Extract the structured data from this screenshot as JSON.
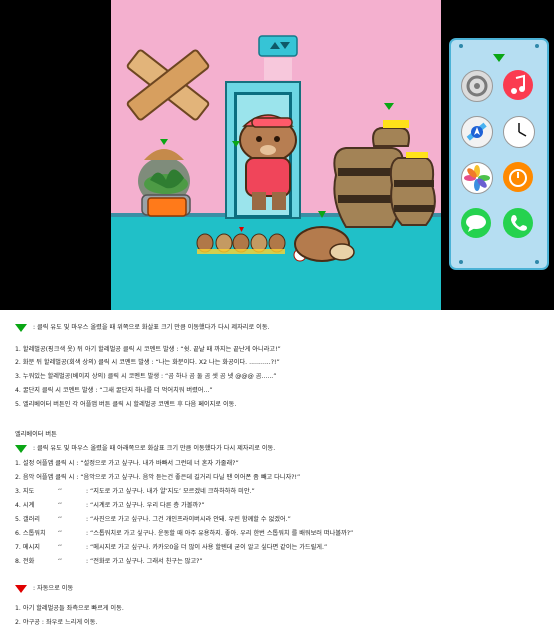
{
  "scene": {
    "colors": {
      "wall": "#f4b0cf",
      "floor": "#20c0c8",
      "phone_border": "#4bb2d6",
      "phone_bg": "#b6def2"
    },
    "elevator_button_icon": "elevator-up-down-icon",
    "apps": [
      {
        "name": "settings-app-icon",
        "color": "#d9d9d9"
      },
      {
        "name": "music-app-icon",
        "color": "#fb3b50"
      },
      {
        "name": "maps-app-icon",
        "color": "#f2f2f2"
      },
      {
        "name": "clock-app-icon",
        "color": "#ffffff"
      },
      {
        "name": "photos-app-icon",
        "color": "#ffffff"
      },
      {
        "name": "stopwatch-app-icon",
        "color": "#ff8a00"
      },
      {
        "name": "messages-app-icon",
        "color": "#25d24f"
      },
      {
        "name": "phone-app-icon",
        "color": "#25d24f"
      }
    ]
  },
  "notes": {
    "green_section": {
      "intro": ": 클릭 유도 및 마우스 올렸을 때 위쪽으로 화살표 크기 만큼 이동했다가 다시 제자리로 이동.",
      "items": [
        "1. 할레벌공(핑크색 옷) 뒤 아기 할레벌공 클릭 시 코멘트 발생 : “쉿. 끝날 때 까지는 끝난게 아니라고!”",
        "2. 화분 뒤 할레벌공(회색 상의) 클릭 시 코멘트 발생 : “나는 화분이다. X2 나는 화공이다. ...........?!”",
        "3. 누워있는 할레벌공(베이지 상의) 클릭 시 코멘트 발생 : “곰 하나 곰 둘 곰 셋 곰 넷 @@@ 곰......”",
        "4. 꿀단지 클릭 시 코멘트 발생 : “그새 꿀단지 하나를 더 먹어치워 버렸어...”",
        "5. 엘리베이터 버튼인 각 어플앱 버튼 클릭 시 할레벌공 코멘트 후 다음 페이지로 이동."
      ]
    },
    "elevator_title": "엘리베이터 버튼",
    "elevator_section": {
      "intro": ": 클릭 유도 및 마우스 올렸을 때 아래쪽으로 화살표 크기 만큼 이동했다가 다시 제자리로 이동.",
      "items": [
        {
          "num": "1. 설정 어플앱 클릭 시 : “설정으로 가고 싶구나. 내가 바빠서 그런데 너 혼자 가줄래?”"
        },
        {
          "num": "2. 음악 어플앱 클릭 시 : “음악으로 가고 싶구나. 음악 듣는건 좋은데 길거리 다닐 땐 이어폰 좀 빼고 다니자?!”"
        },
        {
          "num": "3. 지도",
          "mark": "‘’",
          "desc": ": “지도로 가고 싶구나. 내가 얄’지도’ 모르겠네 크하하하하 미안.”"
        },
        {
          "num": "4. 시계",
          "mark": "‘’",
          "desc": ": “시계로 가고 싶구나. 우리 다른 층 가볼까?”"
        },
        {
          "num": "5. 갤러리",
          "mark": "‘’",
          "desc": ": “사진으로 가고 싶구나. 그건 개인프라이버시라 안돼. 우린 함께할 수 없겠어.”"
        },
        {
          "num": "6. 스톱워치",
          "mark": "‘’",
          "desc": ": “스톱워치로 가고 싶구나. 운동할 때 아주 유용하지. 좋아. 우리 한번 스톱워치 를 배워보러 떠나볼까?”"
        },
        {
          "num": "7. 메시지",
          "mark": "‘’",
          "desc": ": “메시지로 가고 싶구나. 카카오0을 더 많이 사용 할텐데 굳이 알고 싶다면 같이는 가드릴게.”"
        },
        {
          "num": "8. 전화",
          "mark": "‘’",
          "desc": ": “전화로 가고 싶구나. 그래서 친구는 많고?”"
        }
      ]
    },
    "red_section": {
      "intro": ": 자동으로 이동",
      "items": [
        "1. 아기 할레벌공들 좌측으로 빠르게 이동.",
        "2. 야구공 : 좌우로 느리게 이동."
      ]
    }
  }
}
